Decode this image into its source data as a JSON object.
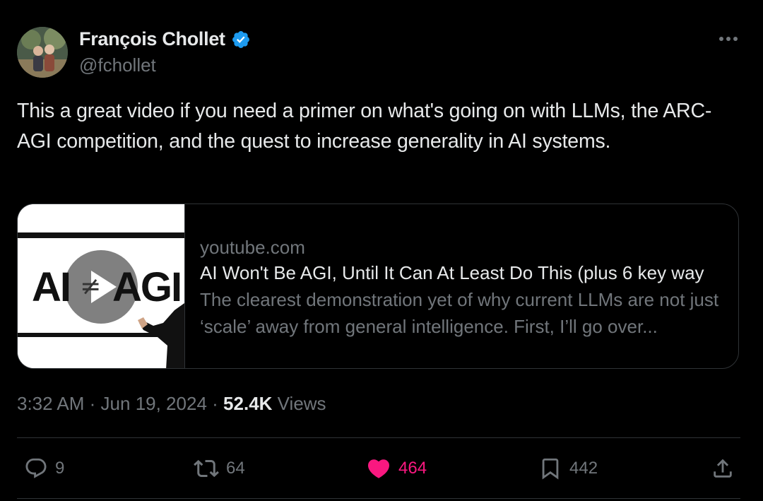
{
  "author": {
    "name": "François Chollet",
    "handle": "@fchollet"
  },
  "tweet_text": "This a great video if you need a primer on what's going on with LLMs, the ARC-AGI competition, and the quest to increase generality in AI systems.",
  "card": {
    "thumbnail_left_text": "AI",
    "thumbnail_symbol": "≠",
    "thumbnail_right_text": "AGI",
    "domain": "youtube.com",
    "title": "AI Won't Be AGI, Until It Can At Least Do This (plus 6 key way",
    "description": "The clearest demonstration yet of why current LLMs are not just ‘scale’ away from general intelligence. First, I’ll go over..."
  },
  "meta": {
    "time": "3:32 AM",
    "separator": "·",
    "date": "Jun 19, 2024",
    "views_count": "52.4K",
    "views_label": "Views"
  },
  "actions": {
    "replies": "9",
    "reposts": "64",
    "likes": "464",
    "bookmarks": "442"
  },
  "colors": {
    "background": "#000000",
    "text": "#e7e9ea",
    "secondary": "#71767b",
    "like": "#f91880",
    "verified": "#1d9bf0",
    "border": "#2f3336"
  }
}
